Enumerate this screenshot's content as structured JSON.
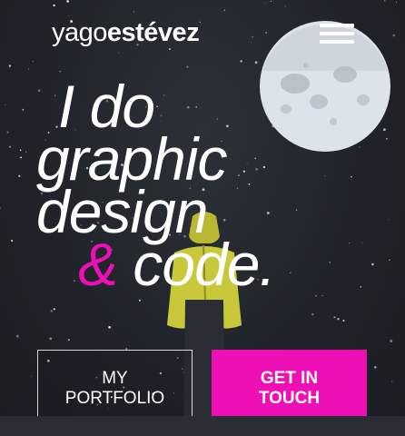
{
  "brand": {
    "light": "yago",
    "bold": "estévez"
  },
  "headline": {
    "line1": "I do",
    "line2": "graphic",
    "line3": "design",
    "amp": "&",
    "line4": "code."
  },
  "buttons": {
    "portfolio": {
      "line1": "MY",
      "line2": "PORTFOLIO"
    },
    "touch": {
      "line1": "GET IN",
      "line2": "TOUCH"
    }
  },
  "colors": {
    "accent": "#ee10b4",
    "background": "#22262c",
    "moon": "#dde3ea",
    "jacket": "#c8c83a"
  },
  "icons": {
    "menu": "hamburger-menu-icon"
  }
}
